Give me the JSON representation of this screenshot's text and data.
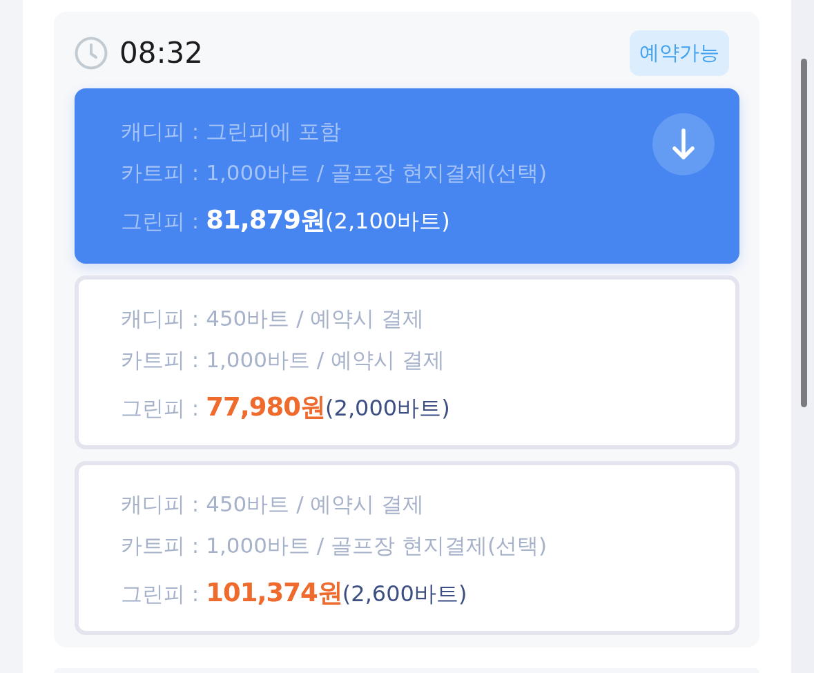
{
  "slot": {
    "time": "08:32",
    "status": "예약가능"
  },
  "options": [
    {
      "selected": true,
      "fees": [
        "캐디피 : 그린피에 포함",
        "카트피 : 1,000바트 / 골프장 현지결제(선택)"
      ],
      "green_fee": {
        "label": "그린피 :",
        "price": "81,879원",
        "baht": "(2,100바트)"
      }
    },
    {
      "selected": false,
      "fees": [
        "캐디피 : 450바트 / 예약시 결제",
        "카트피 : 1,000바트 / 예약시 결제"
      ],
      "green_fee": {
        "label": "그린피 :",
        "price": "77,980원",
        "baht": "(2,000바트)"
      }
    },
    {
      "selected": false,
      "fees": [
        "캐디피 : 450바트 / 예약시 결제",
        "카트피 : 1,000바트 / 골프장 현지결제(선택)"
      ],
      "green_fee": {
        "label": "그린피 :",
        "price": "101,374원",
        "baht": "(2,600바트)"
      }
    }
  ]
}
